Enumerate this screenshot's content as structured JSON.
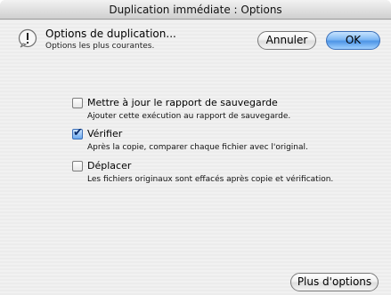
{
  "window": {
    "title": "Duplication immédiate : Options"
  },
  "header": {
    "icon": "alert-icon",
    "title": "Options de duplication...",
    "subtitle": "Options les plus courantes."
  },
  "buttons": {
    "cancel_label": "Annuler",
    "ok_label": "OK",
    "more_label": "Plus d'options"
  },
  "options": [
    {
      "label": "Mettre à jour le rapport de sauvegarde",
      "description": "Ajouter cette exécution au rapport de sauvegarde.",
      "checked": false
    },
    {
      "label": "Vérifier",
      "description": "Après la copie, comparer chaque fichier avec l'original.",
      "checked": true
    },
    {
      "label": "Déplacer",
      "description": "Les fichiers originaux sont effacés après copie et vérification.",
      "checked": false
    }
  ],
  "colors": {
    "default_button": "#4e95e6",
    "window_background": "#ececec"
  }
}
